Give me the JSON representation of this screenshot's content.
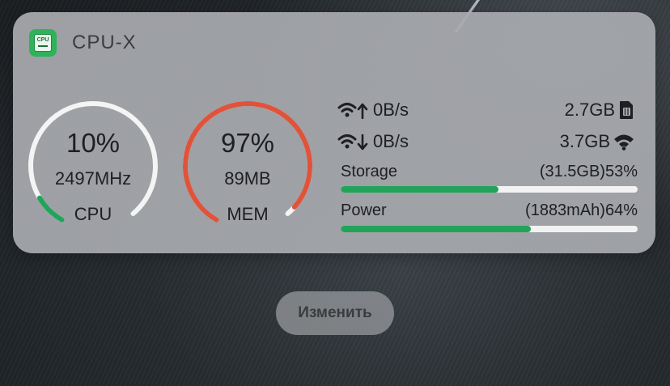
{
  "widget": {
    "app_name": "CPU-X",
    "app_icon_text": "CPU",
    "cpu": {
      "percent_text": "10%",
      "percent": 10,
      "freq": "2497MHz",
      "label": "CPU",
      "color": "#22a35a"
    },
    "mem": {
      "percent_text": "97%",
      "percent": 97,
      "used": "89MB",
      "label": "MEM",
      "color": "#e0533a"
    },
    "network": {
      "upload": "0B/s",
      "download": "0B/s",
      "cellular": "2.7GB",
      "wifi": "3.7GB"
    },
    "storage": {
      "label": "Storage",
      "value": "(31.5GB)53%",
      "fraction": 0.53
    },
    "power": {
      "label": "Power",
      "value": "(1883mAh)64%",
      "fraction": 0.64
    }
  },
  "edit_button": {
    "label": "Изменить"
  },
  "icons": [
    "wifi-upload-icon",
    "wifi-download-icon",
    "sim-card-icon",
    "wifi-icon"
  ]
}
